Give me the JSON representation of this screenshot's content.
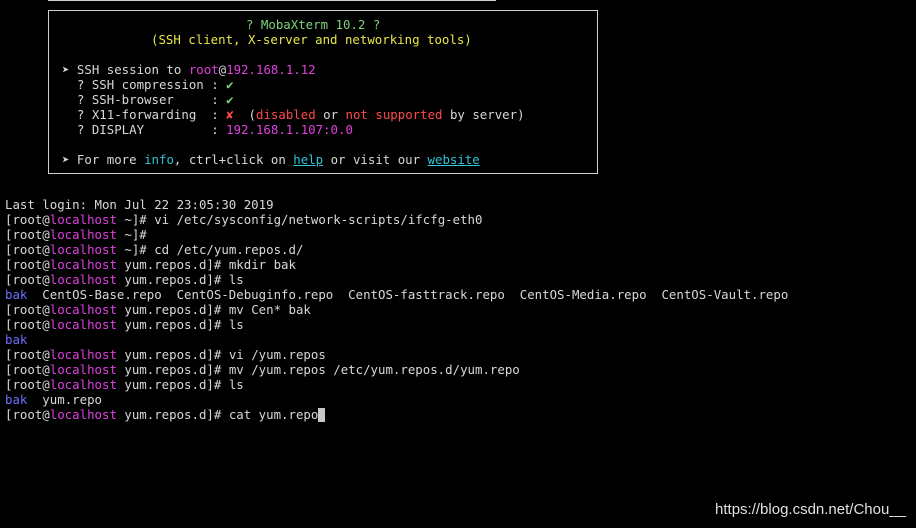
{
  "banner": {
    "title": "? MobaXterm 10.2 ?",
    "subtitle": "(SSH client, X-server and networking tools)",
    "session_prefix": "➤ SSH session to ",
    "session_user": "root",
    "session_at": "@",
    "session_host": "192.168.1.12",
    "compression_label": "  ? SSH compression : ",
    "compression_value": "✔",
    "browser_label": "  ? SSH-browser     : ",
    "browser_value": "✔",
    "x11_label": "  ? X11-forwarding  : ",
    "x11_value": "✘",
    "x11_paren_open": "  (",
    "x11_disabled": "disabled",
    "x11_or": " or ",
    "x11_not_supported": "not supported",
    "x11_by_server": " by server)",
    "display_label": "  ? DISPLAY         : ",
    "display_value": "192.168.1.107:0.0",
    "more_prefix": "➤ For more ",
    "more_info": "info",
    "more_mid": ", ctrl+click on ",
    "more_help": "help",
    "more_or_visit": " or visit our ",
    "more_website": "website"
  },
  "terminal": {
    "last_login": "Last login: Mon Jul 22 23:05:30 2019",
    "prompt_open": "[root@",
    "prompt_host": "localhost",
    "lines": [
      {
        "dir": " ~]# ",
        "cmd": "vi /etc/sysconfig/network-scripts/ifcfg-eth0"
      },
      {
        "dir": " ~]#",
        "cmd": ""
      },
      {
        "dir": " ~]# ",
        "cmd": "cd /etc/yum.repos.d/"
      },
      {
        "dir": " yum.repos.d]# ",
        "cmd": "mkdir bak"
      },
      {
        "dir": " yum.repos.d]# ",
        "cmd": "ls"
      },
      {
        "dir": " yum.repos.d]# ",
        "cmd": "mv Cen* bak"
      },
      {
        "dir": " yum.repos.d]# ",
        "cmd": "ls"
      },
      {
        "dir": " yum.repos.d]# ",
        "cmd": "vi /yum.repos"
      },
      {
        "dir": " yum.repos.d]# ",
        "cmd": "mv /yum.repos /etc/yum.repos.d/yum.repo"
      },
      {
        "dir": " yum.repos.d]# ",
        "cmd": "ls"
      },
      {
        "dir": " yum.repos.d]# ",
        "cmd": "cat yum.repo"
      }
    ],
    "ls1_dir": "bak",
    "ls1_files": "  CentOS-Base.repo  CentOS-Debuginfo.repo  CentOS-fasttrack.repo  CentOS-Media.repo  CentOS-Vault.repo",
    "ls2_dir": "bak",
    "ls3_dir": "bak",
    "ls3_files": "  yum.repo"
  },
  "watermark": "https://blog.csdn.net/Chou__",
  "colors": {
    "background": "#000000",
    "text": "#d8d8d8",
    "hostname": "#e040e0",
    "directory": "#6e6eff",
    "link": "#2ec4d6"
  }
}
